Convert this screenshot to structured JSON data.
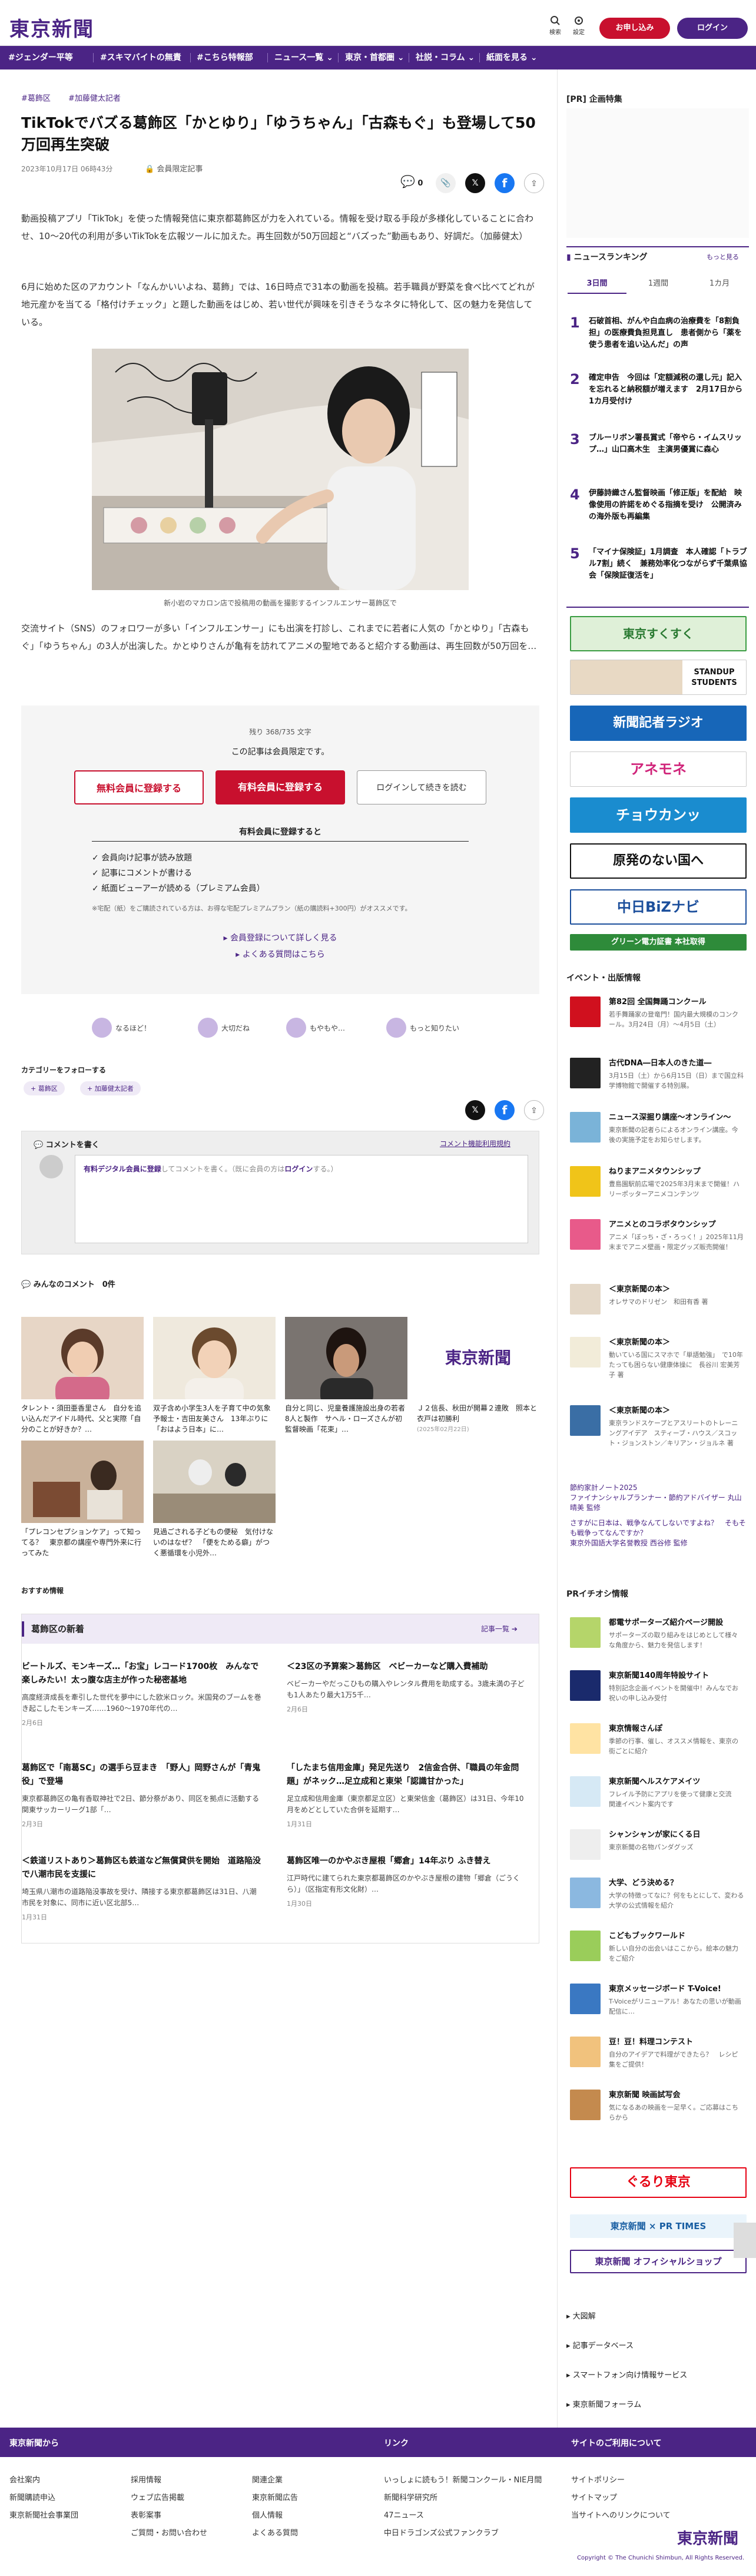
{
  "header": {
    "logo": "東京新聞",
    "search_label": "検索",
    "menu_label": "設定",
    "register_label": "お申し込み",
    "login_label": "ログイン"
  },
  "nav": {
    "items": [
      "#ジェンダー平等",
      "#スキマバイトの無責",
      "#こちら特報部",
      "ニュース一覧",
      "東京・首都圏",
      "社説・コラム",
      "紙面を見る"
    ]
  },
  "article": {
    "tags": [
      "#葛飾区",
      "#加藤健太記者"
    ],
    "title": "TikTokでバズる葛飾区「かとゆり」「ゆうちゃん」「古森もぐ」も登場して50万回再生突破",
    "date": "2023年10月17日 06時43分",
    "members_only": "会員限定記事",
    "comment_count_badge": "0",
    "para1": "動画投稿アプリ「TikTok」を使った情報発信に東京都葛飾区が力を入れている。情報を受け取る手段が多様化していることに合わせ、10〜20代の利用が多いTikTokを広報ツールに加えた。再生回数が50万回超と“バズった”動画もあり、好調だ。（加藤健太）",
    "para2": "6月に始めた区のアカウント「なんかいいよね、葛飾」では、16日時点で31本の動画を投稿。若手職員が野菜を食べ比べてどれが地元産かを当てる「格付けチェック」と題した動画をはじめ、若い世代が興味を引きそうなネタに特化して、区の魅力を発信している。",
    "photo_caption": "新小岩のマカロン店で投稿用の動画を撮影するインフルエンサー葛飾区で",
    "para3": "交流サイト（SNS）のフォロワーが多い「インフルエンサー」にも出演を打診し、これまでに若者に人気の「かとゆり」「古森もぐ」「ゆうちゃん」の3人が出演した。かとゆりさんが亀有を訪れてアニメの聖地であると紹介する動画は、再生回数が50万回を…"
  },
  "paywall": {
    "remaining": "残り 368/735 文字",
    "notice": "この記事は会員限定です。",
    "free_btn": "無料会員に登録する",
    "paid_btn": "有料会員に登録する",
    "login_btn": "ログインして続きを読む",
    "benefit_title": "有料会員に登録すると",
    "benefits": [
      "会員向け記事が読み放題",
      "記事にコメントが書ける",
      "紙面ビューアーが読める（プレミアム会員）"
    ],
    "note": "※宅配（紙）をご購読されている方は、お得な宅配プレミアムプラン（紙の購読料+300円）がオススメです。",
    "link1": "会員登録について詳しく見る",
    "link2": "よくある質問はこちら"
  },
  "reactions": [
    "なるほど！",
    "大切だね",
    "もやもや…",
    "もっと知りたい"
  ],
  "follow": {
    "label": "カテゴリーをフォローする",
    "chips": [
      "葛飾区",
      "加藤健太記者"
    ]
  },
  "comments": {
    "write_label": "コメントを書く",
    "guideline_link": "コメント機能利用規約",
    "prompt_link": "有料デジタル会員に登録",
    "prompt_text": "してコメントを書く。（既に会員の方は",
    "prompt_login": "ログイン",
    "prompt_end": "する。）",
    "everyone_label": "みんなのコメント",
    "everyone_count": "0件"
  },
  "related": [
    {
      "caption": "タレント・須田亜香里さん　自分を追い込んだアイドル時代、父と実際「自分のことが好きか？…",
      "date": ""
    },
    {
      "caption": "双子含め小学生3人を子育て中の気象予報士・吉田友美さん　13年ぶりに「おはよう日本」に…",
      "date": ""
    },
    {
      "caption": "自分と同じ、児童養護施設出身の若者8人と製作　サヘル・ローズさんが初監督映画「花束」…",
      "date": ""
    },
    {
      "caption": "Ｊ２信長、秋田が開幕２連敗　照本と衣戸は初勝利",
      "date": "(2025年02月22日)"
    },
    {
      "caption": "「プレコンセプションケア」って知ってる？　東京都の講座や専門外来に行ってみた",
      "date": ""
    },
    {
      "caption": "見過ごされる子どもの便秘　気付けないのはなぜ？　「便をためる癖」がつく悪循環を小児外…",
      "date": ""
    }
  ],
  "recommend_label": "おすすめ情報",
  "area_news": {
    "title": "葛飾区の新着",
    "more": "記事一覧 ➔",
    "items": [
      {
        "title": "ビートルズ、モンキーズ…「お宝」レコード1700枚　みんなで楽しみたい！太っ腹な店主が作った秘密基地",
        "body": "高度経済成長を牽引した世代を夢中にした欧米ロック。米国発のブームを巻き起こしたモンキーズ……1960〜1970年代の…",
        "date": "2月6日"
      },
      {
        "title": "＜23区の予算案＞葛飾区　ベビーカーなど購入費補助",
        "body": "ベビーカーやだっこひもの購入やレンタル費用を助成する。3歳未満の子ども1人あたり最大1万5千…",
        "date": "2月6日"
      },
      {
        "title": "葛飾区で「南葛SC」の選手ら豆まき　「野人」岡野さんが「青鬼役」で登場",
        "body": "東京都葛飾区の亀有香取神社で2日、節分祭があり、同区を拠点に活動する関東サッカーリーグ1部「…",
        "date": "2月3日"
      },
      {
        "title": "「したまち信用金庫」発足先送り　2信金合併、「職員の年金問題」がネック…足立成和と東栄「認識甘かった」",
        "body": "足立成和信用金庫（東京都足立区）と東栄信金（葛飾区）は31日、今年10月をめどとしていた合併を延期す…",
        "date": "1月31日"
      },
      {
        "title": "＜鉄道リストあり＞葛飾区も鉄道など無償貸供を開始　道路陥没で八潮市民を支援に",
        "body": "埼玉県八潮市の道路陥没事故を受け、隣接する東京都葛飾区は31日、八潮市民を対象に、同市に近い区北部5…",
        "date": "1月31日"
      },
      {
        "title": "葛飾区唯一のかやぶき屋根「郷倉」14年ぶり ふき替え",
        "body": "江戸時代に建てられた東京都葛飾区のかやぶき屋根の建物「郷倉（ごうくら）」（区指定有形文化財）…",
        "date": "1月30日"
      }
    ]
  },
  "sidebar": {
    "pr_label": "[PR] 企画特集",
    "ranking_title": "ニュースランキング",
    "ranking_more": "もっと見る",
    "ranking_tabs": [
      "3日間",
      "1週間",
      "1カ月"
    ],
    "ranking": [
      "石破首相、がんや白血病の治療費を「8割負担」の医療費負担見直し　患者側から「薬を使う患者を追い込んだ」の声",
      "確定申告　今回は「定額減税の還し元」記入を忘れると納税額が増えます　2月17日から1カ月受付け",
      "ブルーリボン署長賞式「帝やら・イムスリップ…」山口高木生　主演男優賞に森心",
      "伊藤詩織さん監督映画「修正版」を配給　映像使用の許諾をめぐる指摘を受け　公開済みの海外版も再編集",
      "「マイナ保険証」1月調査　本人確認「トラブル7割」続く　兼務効率化つながらず千葉県協会「保険証復活を」"
    ],
    "banners": [
      "東京すくすく",
      "STANDUP STUDENTS",
      "新聞記者ラジオ",
      "アネモネ",
      "チョウカンッ",
      "原発のない国へ",
      "中日BiZナビ",
      "グリーン電力証書 本社取得"
    ],
    "event_title": "イベント・出版情報",
    "events": [
      {
        "title": "第82回 全国舞踊コンクール",
        "body": "若手舞踊家の登竜門！国内最大規模のコンクール。3月24日（月）〜4月5日（土）"
      },
      {
        "title": "古代DNA―日本人のきた道―",
        "body": "3月15日（土）から6月15日（日）まで国立科学博物館で開催する特別展。"
      },
      {
        "title": "ニュース深掘り講座〜オンライン〜",
        "body": "東京新聞の記者らによるオンライン講座。今後の実施予定をお知らせします。"
      },
      {
        "title": "ねりまアニメタウンシップ",
        "body": "豊島園駅前広場で2025年3月末まで開催！ハリーポッターアニメコンテンツ"
      },
      {
        "title": "アニメとのコラボタウンシップ",
        "body": "アニメ「ぼっち・ざ・ろっく！」2025年11月末までアニメ壁画・限定グッズ販売開催！"
      },
      {
        "title": "＜東京新聞の本＞",
        "body": "オレサマのドリゼン　和田有香 著"
      },
      {
        "title": "＜東京新聞の本＞",
        "body": "動いている国にスマホで「単語勉強」　で10年たっても困らない健康体操に　長谷川 宏美芳子 著"
      },
      {
        "title": "＜東京新聞の本＞",
        "body": "東京ランドスケープとアスリートのトレーニングアイデア　スティーブ・ハウス／スコット・ジョンストン／キリアン・ジョルネ 著"
      }
    ],
    "column1_title": "節約家計ノート2025",
    "column1_body": "ファイナンシャルプランナー・節約アドバイザー 丸山晴美 監修",
    "column2_title": "さすがに日本は、戦争なんてしないですよね？　そもそも戦争ってなんですか？",
    "column2_body": "東京外国語大学名誉教授 西谷修 監修",
    "pr_event_title": "PRイチオシ情報",
    "pr_events": [
      {
        "title": "都電サポーターズ紹介ページ開設",
        "body": "サポーターズの取り組みをはじめとして様々な角度から、魅力を発信します！"
      },
      {
        "title": "東京新聞140周年特設サイト",
        "body": "特別記念企画イベントを開催中！みんなでお祝いの申し込み受付"
      },
      {
        "title": "東京情報さんぽ",
        "body": "季節の行事、催し、オススメ情報を、東京の街ごとに紹介"
      },
      {
        "title": "東京新聞ヘルスケアメイツ",
        "body": "フレイル予防にアプリを使って健康と交流　関連イベント案内です"
      },
      {
        "title": "シャンシャンが家にくる日",
        "body": "東京新聞の名物パンダグッズ"
      },
      {
        "title": "大学、どう決める？",
        "body": "大学の特徴ってなに？何をもとにして、変わる大学の公式情報を紹介"
      },
      {
        "title": "こどもブックワールド",
        "body": "新しい自分の出会いはここから。絵本の魅力をご紹介"
      },
      {
        "title": "東京メッセージボード T-Voice!",
        "body": "T-Voiceがリニューアル！あなたの思いが動画配信に…"
      },
      {
        "title": "豆！豆！料理コンテスト",
        "body": "自分のアイデアで料理ができたら？　レシピ集をご提供！"
      },
      {
        "title": "東京新聞 映画試写会",
        "body": "気になるあの映画を一足早く。ご応募はこちらから"
      }
    ],
    "bottom_banners": [
      "ぐるり東京",
      "東京新聞 × PR TIMES",
      "東京新聞 オフィシャルショップ"
    ],
    "links": [
      "大図解",
      "記事データベース",
      "スマートフォン向け情報サービス",
      "東京新聞フォーラム"
    ]
  },
  "footer": {
    "col1_title": "東京新聞から",
    "col2_title": "リンク",
    "col3_title": "サイトのご利用について",
    "col1": [
      "会社案内",
      "新聞購読申込",
      "東京新聞社会事業団"
    ],
    "col1b": [
      "採用情報",
      "ウェブ広告掲載",
      "表彰案事",
      "ご質問・お問い合わせ"
    ],
    "col1c": [
      "関連企業",
      "東京新聞広告",
      "個人情報",
      "よくある質問"
    ],
    "col2": [
      "いっしょに読もう！新聞コンクール・NIE月間",
      "新聞科学研究所",
      "47ニュース",
      "中日ドラゴンズ公式ファンクラブ"
    ],
    "col3": [
      "サイトポリシー",
      "サイトマップ",
      "当サイトへのリンクについて"
    ],
    "logo": "東京新聞",
    "copyright": "Copyright © The Chunichi Shimbun, All Rights Reserved."
  },
  "colors": {
    "brand": "#4b2485",
    "accent": "#c8102e"
  }
}
